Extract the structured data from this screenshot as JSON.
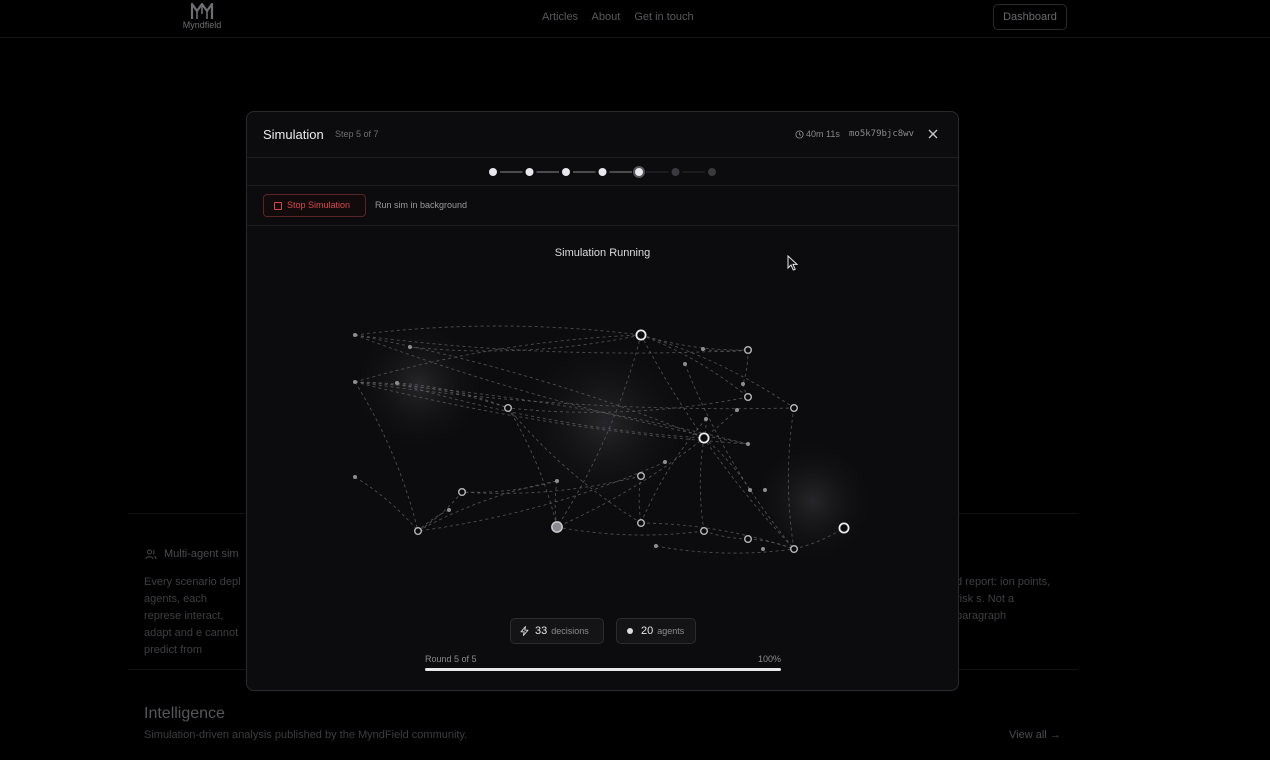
{
  "brand": {
    "name": "Myndfield"
  },
  "nav": {
    "links": [
      "Articles",
      "About",
      "Get in touch"
    ],
    "dashboard_label": "Dashboard"
  },
  "background": {
    "feature_title": "Multi-agent sim",
    "left_text": "Every scenario depl agents, each represe interact, adapt and e cannot predict from",
    "right_text": "d report: ion points, risk s. Not a paragraph",
    "intel_title": "Intelligence",
    "intel_subtitle": "Simulation-driven analysis published by the MyndField community.",
    "view_all": "View all →"
  },
  "modal": {
    "title": "Simulation",
    "step_label": "Step 5 of 7",
    "timer": "40m 11s",
    "sim_id": "mo5k79bjc8wv",
    "stepper": {
      "total": 7,
      "completed": 4,
      "current": 5
    },
    "stop_label": "Stop Simulation",
    "background_label": "Run sim in background",
    "status_title": "Simulation Running",
    "decisions": {
      "value": "33",
      "label": "decisions"
    },
    "agents": {
      "value": "20",
      "label": "agents"
    },
    "round_label": "Round 5 of 5",
    "progress_label": "100%",
    "progress": 1.0
  },
  "colors": {
    "accent_red": "#d9474a",
    "node": "#e8e8ec",
    "edge": "#6a6a6e"
  }
}
